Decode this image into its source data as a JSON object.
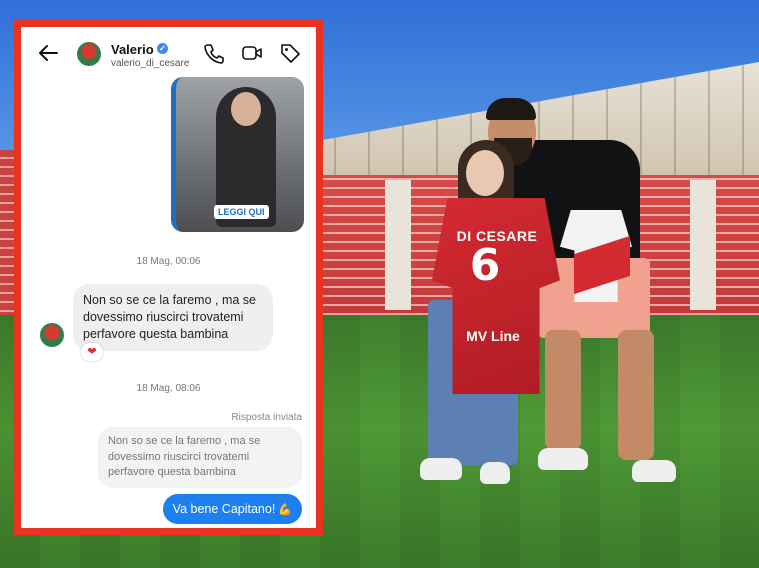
{
  "chat": {
    "contact_name": "Valerio",
    "contact_handle": "valerio_di_cesare",
    "icons": {
      "back": "arrow-left-icon",
      "verified": "verified-badge-icon",
      "call": "phone-icon",
      "video": "video-camera-icon",
      "tag": "tag-icon"
    },
    "story_button": "LEGGI QUI",
    "messages": [
      {
        "timestamp": "18 Mag, 00:06"
      },
      {
        "text": "Non so se ce la faremo , ma se dovessimo riuscirci trovatemi perfavore questa bambina",
        "reaction": "❤"
      },
      {
        "timestamp": "18 Mag, 08:06"
      },
      {
        "reply_label": "Risposta inviata"
      },
      {
        "quoted": "Non so se ce la faremo , ma se dovessimo riuscirci trovatemi perfavore questa bambina"
      },
      {
        "text": "Va bene Capitano!",
        "emoji": "💪"
      }
    ]
  },
  "photo": {
    "jersey_name": "DI CESARE",
    "jersey_number": "6",
    "jersey_sponsor": "MV Line"
  },
  "colors": {
    "frame": "#e9321f",
    "outgoing_bubble": "#1d7ff0",
    "incoming_bubble": "#efefef",
    "verified": "#3a8cf0"
  }
}
